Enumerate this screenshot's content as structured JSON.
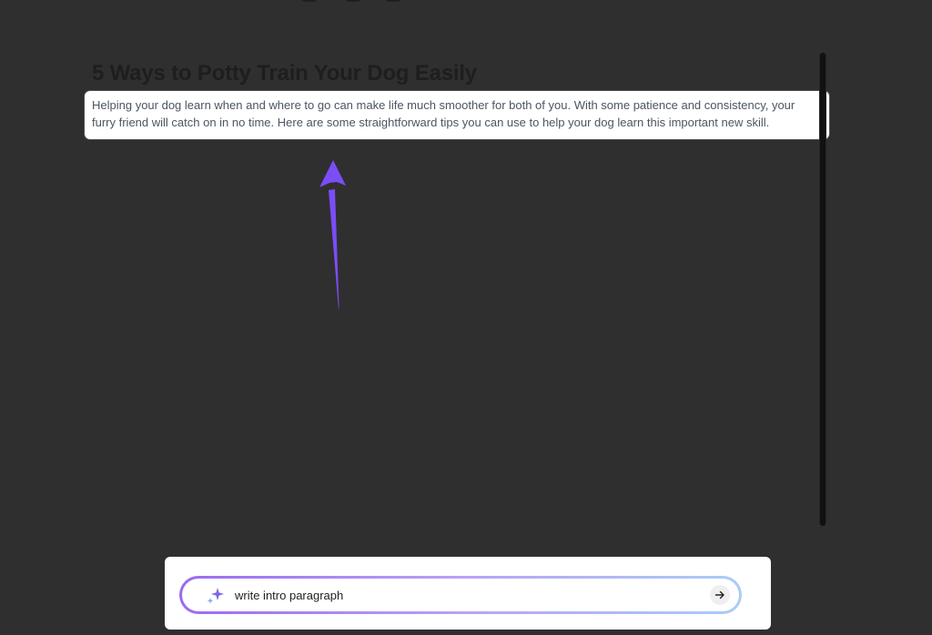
{
  "document": {
    "title": "5 Ways to Potty Train Your Dog Easily",
    "intro_paragraph": "Helping your dog learn when and where to go can make life much smoother for both of you. With some patience and consistency, your furry friend will catch on in no time. Here are some straightforward tips you can use to help your dog learn this important new skill."
  },
  "prompt": {
    "value": "write intro paragraph",
    "icon": "sparkle-icon",
    "send_icon": "arrow-right-icon"
  },
  "annotation": {
    "icon": "arrow-up-icon"
  },
  "colors": {
    "background": "#2f2f2f",
    "title": "#1e1e1e",
    "intro_text": "#4b5563",
    "arrow": "#7b4df5",
    "sparkle": "#7b67e8",
    "gradient_start": "#9a6bf2",
    "gradient_end": "#a9cdf7"
  }
}
